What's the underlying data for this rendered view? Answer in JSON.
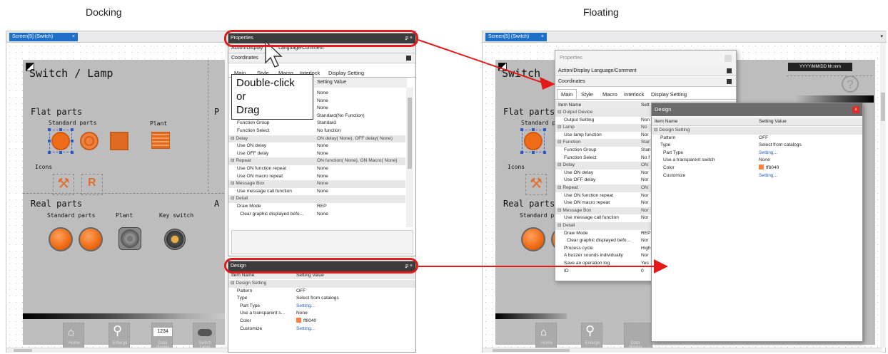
{
  "captions": {
    "docking": "Docking",
    "floating": "Floating"
  },
  "left": {
    "tab_title": "Screen[5] (Switch)",
    "close_glyph": "×",
    "screen_title": "Switch / Lamp",
    "flat_parts": "Flat parts",
    "standard_parts": "Standard parts",
    "plant": "Plant",
    "icons": "Icons",
    "real_parts": "Real parts",
    "plant2": "Plant",
    "key_switch": "Key switch",
    "p_letter": "P",
    "a_letter": "A",
    "home": "Home",
    "enlarge": "Enlarge",
    "data_display": "Data display",
    "switch_lamp": "Switch Lamp",
    "num1234": "1234"
  },
  "properties": {
    "title": "Properties",
    "pin_close": "ᵱ ×",
    "action_display": "Action/Display",
    "lang_comment": "Language/Comment",
    "coordinates": "Coordinates",
    "tabs": [
      "Main",
      "Style",
      "Macro",
      "Interlock",
      "Display Setting"
    ],
    "header_value": "Setting Value",
    "callout": [
      "Double-click",
      "or",
      "Drag"
    ],
    "rows": [
      {
        "n": "",
        "v": "None",
        "k": "item"
      },
      {
        "n": "",
        "v": "None",
        "k": "item"
      },
      {
        "n": "",
        "v": "None",
        "k": "item"
      },
      {
        "n": "",
        "v": "Standard(No Function)",
        "k": "item"
      },
      {
        "n": "Function Group",
        "v": "Standard",
        "k": "sub"
      },
      {
        "n": "Function Select",
        "v": "No function",
        "k": "sub"
      },
      {
        "n": "⊟  Delay",
        "v": "ON delay( None), OFF delay( None)",
        "k": "cat"
      },
      {
        "n": "Use ON delay",
        "v": "None",
        "k": "sub"
      },
      {
        "n": "Use OFF delay",
        "v": "None",
        "k": "sub"
      },
      {
        "n": "⊟  Repeat",
        "v": "ON function( None), ON Macro( None)",
        "k": "cat"
      },
      {
        "n": "Use ON function repeat",
        "v": "None",
        "k": "sub"
      },
      {
        "n": "Use ON macro repeat",
        "v": "None",
        "k": "sub"
      },
      {
        "n": "⊟  Message Box",
        "v": "None",
        "k": "cat"
      },
      {
        "n": "Use message call function",
        "v": "None",
        "k": "sub"
      },
      {
        "n": "⊟  Detail",
        "v": "",
        "k": "cat"
      },
      {
        "n": "Draw Mode",
        "v": "REP",
        "k": "sub"
      },
      {
        "n": "Clear graphic displayed befo...",
        "v": "None",
        "k": "sub2"
      }
    ]
  },
  "design_dock": {
    "title": "Design",
    "pin_close": "ᵱ ×",
    "header_name": "Item Name",
    "header_value": "Setting Value",
    "rows": [
      {
        "n": "⊟  Design Setting",
        "v": "",
        "k": "cat"
      },
      {
        "n": "Pattern",
        "v": "OFF",
        "k": "sub"
      },
      {
        "n": "Type",
        "v": "Select from catalogs",
        "k": "sub"
      },
      {
        "n": "Part Type",
        "v": "Setting...",
        "k": "sub2",
        "link": true
      },
      {
        "n": "Use a transparent s...",
        "v": "None",
        "k": "sub2"
      },
      {
        "n": "Color",
        "v": "ff8040",
        "k": "sub2",
        "swatch": true
      },
      {
        "n": "Customize",
        "v": "Setting...",
        "k": "sub2",
        "link": true
      }
    ]
  },
  "right": {
    "tab_title": "Screen[5] (Switch)",
    "close_glyph": "×",
    "screen_title": "Switch",
    "flat_parts": "Flat parts",
    "standard": "Standard p",
    "icons": "Icons",
    "real_parts": "Real parts",
    "standard2": "Standard p",
    "date_text": "YYYY/MM/DD hh:mm",
    "help": "?",
    "home": "Home",
    "enlarge": "Enlarge",
    "data_display": "Data display"
  },
  "props_float": {
    "title": "Properties",
    "action_display": "Action/Display Language/Comment",
    "coordinates": "Coordinates",
    "tabs": [
      "Main",
      "Style",
      "Macro",
      "Interlock",
      "Display Setting"
    ],
    "header_name": "Item Name",
    "header_value": "Sett",
    "rows": [
      {
        "n": "⊟  Output Device",
        "v": "",
        "k": "cat"
      },
      {
        "n": "Output Setting",
        "v": "Non",
        "k": "sub"
      },
      {
        "n": "⊟  Lamp",
        "v": "No",
        "k": "cat"
      },
      {
        "n": "Use lamp function",
        "v": "Nor",
        "k": "sub"
      },
      {
        "n": "⊟  Function",
        "v": "Star",
        "k": "cat"
      },
      {
        "n": "Function Group",
        "v": "Stan",
        "k": "sub"
      },
      {
        "n": "Function Select",
        "v": "No f",
        "k": "sub"
      },
      {
        "n": "⊟  Delay",
        "v": "ON",
        "k": "cat"
      },
      {
        "n": "Use ON delay",
        "v": "Nor",
        "k": "sub"
      },
      {
        "n": "Use OFF delay",
        "v": "Nor",
        "k": "sub"
      },
      {
        "n": "⊟  Repeat",
        "v": "ON",
        "k": "cat"
      },
      {
        "n": "Use ON function repeat",
        "v": "Nor",
        "k": "sub"
      },
      {
        "n": "Use ON macro repeat",
        "v": "Nor",
        "k": "sub"
      },
      {
        "n": "⊟  Message Box",
        "v": "Nor",
        "k": "cat"
      },
      {
        "n": "Use message call function",
        "v": "Nor",
        "k": "sub"
      },
      {
        "n": "⊟  Detail",
        "v": "",
        "k": "cat"
      },
      {
        "n": "Draw Mode",
        "v": "REP",
        "k": "sub"
      },
      {
        "n": "Clear graphic displayed befo...",
        "v": "Nor",
        "k": "sub2"
      },
      {
        "n": "Process cycle",
        "v": "High",
        "k": "sub"
      },
      {
        "n": "A buzzer sounds individually",
        "v": "Nor",
        "k": "sub"
      },
      {
        "n": "Save an operation log",
        "v": "Yes",
        "k": "sub"
      },
      {
        "n": "ID",
        "v": "0",
        "k": "sub"
      }
    ]
  },
  "design_float": {
    "title": "Design",
    "close": "x",
    "header_name": "Item Name",
    "header_value": "Setting Value",
    "rows": [
      {
        "n": "⊟  Design Setting",
        "v": "",
        "k": "cat"
      },
      {
        "n": "Pattern",
        "v": "OFF",
        "k": "sub"
      },
      {
        "n": "Type",
        "v": "Select from catalogs",
        "k": "sub"
      },
      {
        "n": "Part Type",
        "v": "Setting...",
        "k": "sub2",
        "link": true
      },
      {
        "n": "Use a transparent switch",
        "v": "None",
        "k": "sub2"
      },
      {
        "n": "Color",
        "v": "ff8040",
        "k": "sub2",
        "swatch": true
      },
      {
        "n": "Customize",
        "v": "Setting...",
        "k": "sub2",
        "link": true
      }
    ]
  },
  "colors": {
    "accent": "#1e6fc7",
    "highlight": "#e01b1b",
    "swatch": "#ff8040"
  }
}
